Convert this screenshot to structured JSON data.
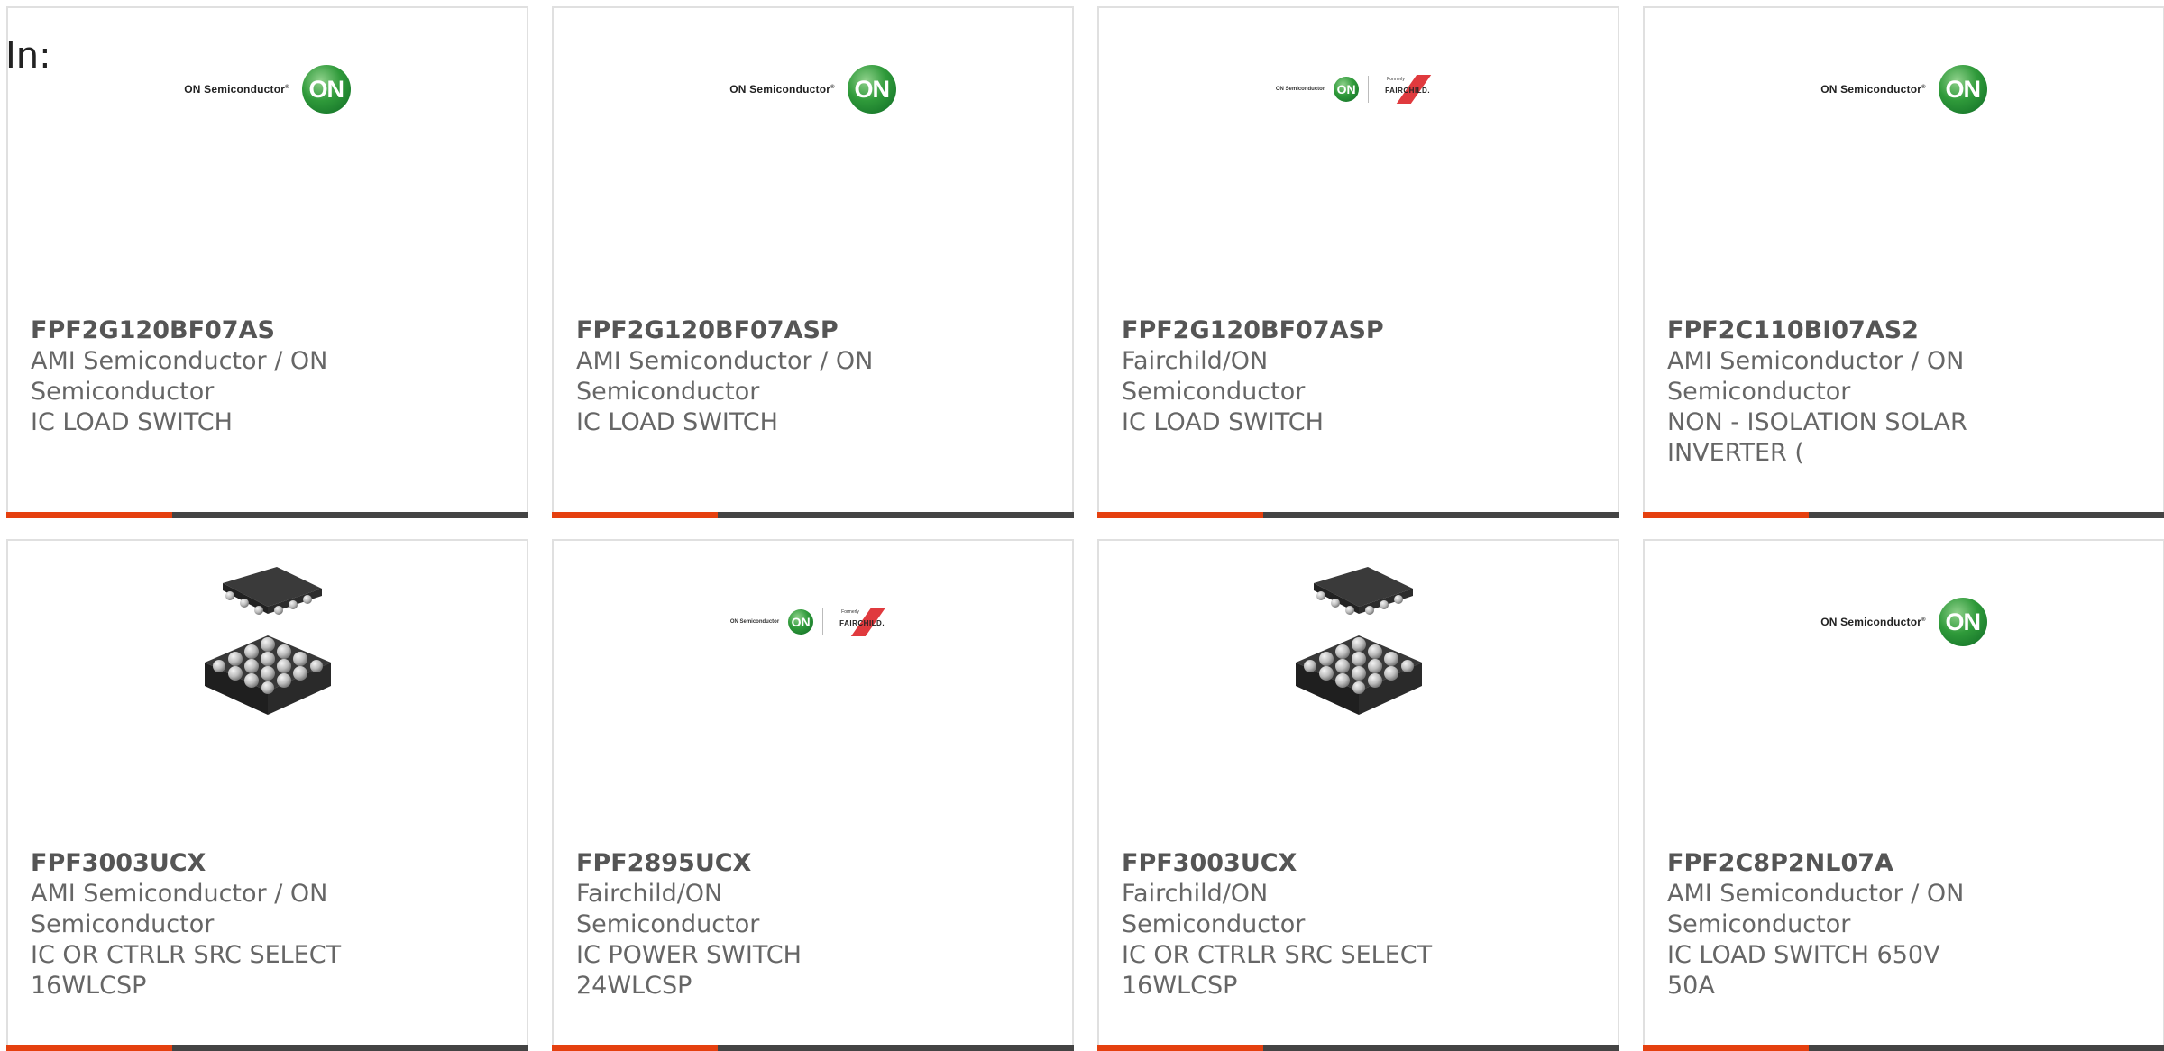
{
  "filter_label": "In:",
  "colors": {
    "accent_bar": "#e5400f",
    "bar": "#444444",
    "on_green": "#2f9a3a",
    "fairchild_red": "#e03a3e"
  },
  "logos": {
    "on_text": "ON Semiconductor",
    "on_mark": "ON",
    "fairchild_formerly": "Formerly",
    "fairchild_name": "FAIRCHILD."
  },
  "products": [
    {
      "image": "on-semiconductor-logo",
      "part_number": "FPF2G120BF07AS",
      "manufacturer": "AMI Semiconductor / ON Semiconductor",
      "description": "IC LOAD SWITCH"
    },
    {
      "image": "on-semiconductor-logo",
      "part_number": "FPF2G120BF07ASP",
      "manufacturer": "AMI Semiconductor / ON Semiconductor",
      "description": "IC LOAD SWITCH"
    },
    {
      "image": "on-fairchild-logo",
      "part_number": "FPF2G120BF07ASP",
      "manufacturer": "Fairchild/ON Semiconductor",
      "description": "IC LOAD SWITCH"
    },
    {
      "image": "on-semiconductor-logo",
      "part_number": "FPF2C110BI07AS2",
      "manufacturer": "AMI Semiconductor / ON Semiconductor",
      "description": "NON - ISOLATION SOLAR INVERTER ("
    },
    {
      "image": "wlcsp-chip",
      "part_number": "FPF3003UCX",
      "manufacturer": "AMI Semiconductor / ON Semiconductor",
      "description": "IC OR CTRLR SRC SELECT 16WLCSP"
    },
    {
      "image": "on-fairchild-logo",
      "part_number": "FPF2895UCX",
      "manufacturer": "Fairchild/ON Semiconductor",
      "description": "IC POWER SWITCH 24WLCSP"
    },
    {
      "image": "wlcsp-chip",
      "part_number": "FPF3003UCX",
      "manufacturer": "Fairchild/ON Semiconductor",
      "description": "IC OR CTRLR SRC SELECT 16WLCSP"
    },
    {
      "image": "on-semiconductor-logo",
      "part_number": "FPF2C8P2NL07A",
      "manufacturer": "AMI Semiconductor / ON Semiconductor",
      "description": "IC LOAD SWITCH 650V 50A"
    }
  ]
}
